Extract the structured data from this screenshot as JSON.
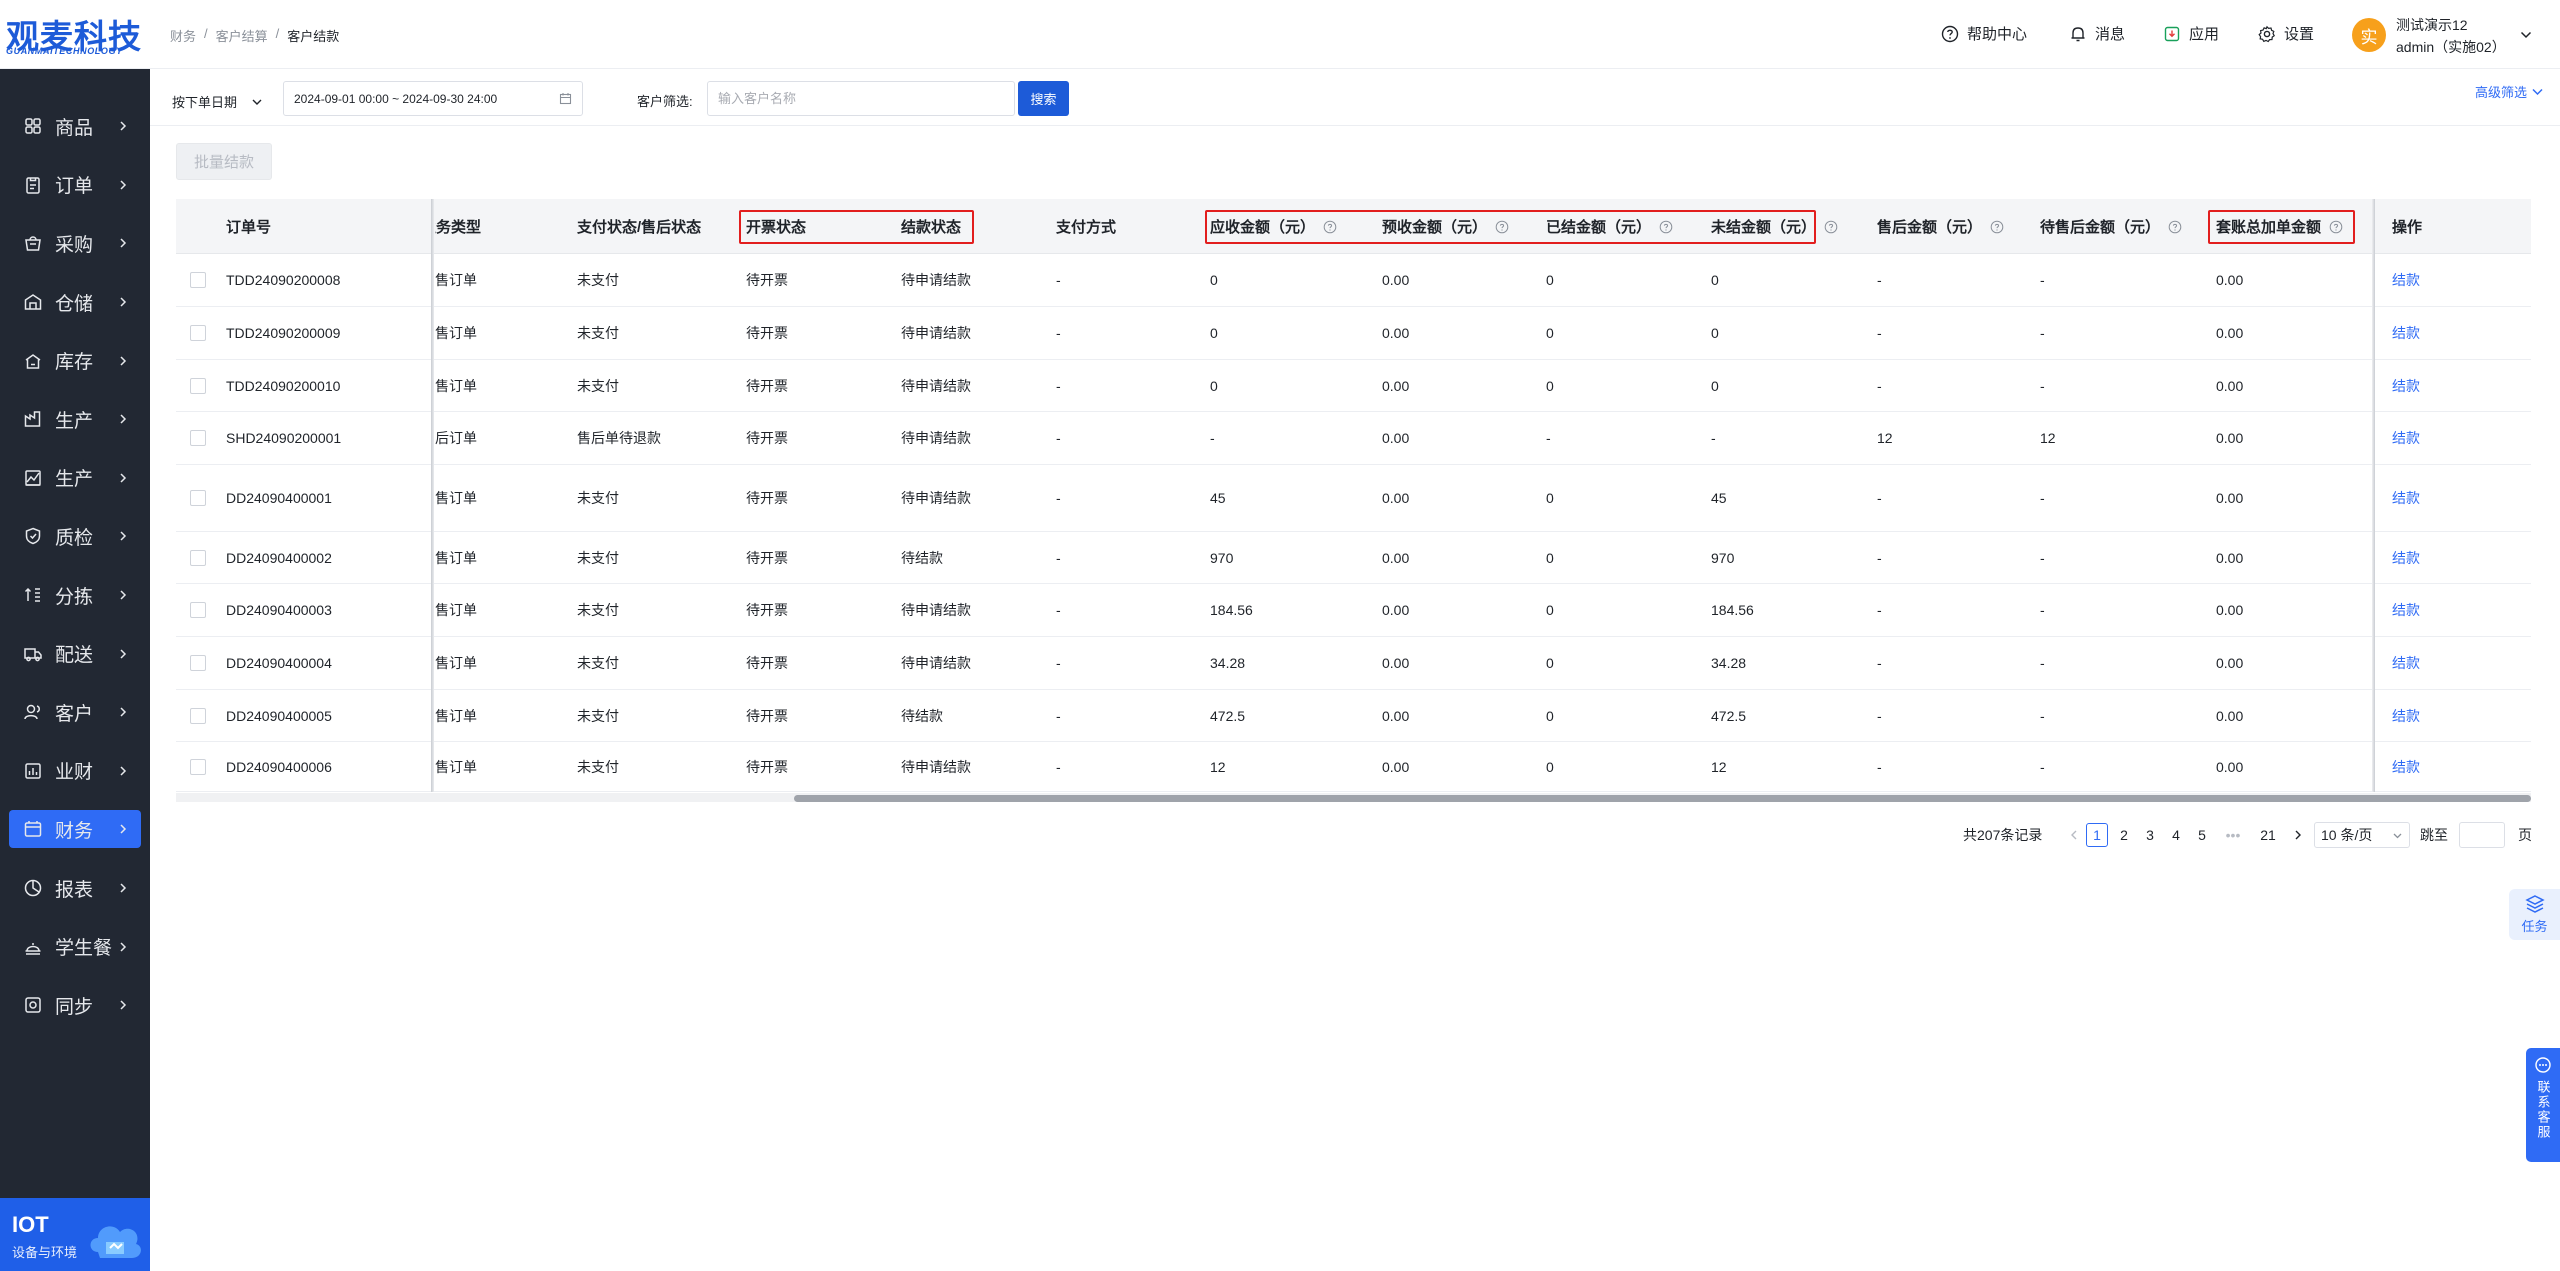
{
  "brand": {
    "logo_text": "观麦科技",
    "logo_sub": "GUANMAITECHNOLOGY"
  },
  "sidebar": {
    "items": [
      {
        "label": "商品",
        "icon": "grid-icon",
        "active": false
      },
      {
        "label": "订单",
        "icon": "order-icon",
        "active": false
      },
      {
        "label": "采购",
        "icon": "purchase-icon",
        "active": false
      },
      {
        "label": "仓储",
        "icon": "warehouse-icon",
        "active": false
      },
      {
        "label": "库存",
        "icon": "inventory-icon",
        "active": false
      },
      {
        "label": "生产",
        "icon": "production-icon",
        "active": false
      },
      {
        "label": "生产",
        "icon": "production-chart-icon",
        "active": false
      },
      {
        "label": "质检",
        "icon": "shield-icon",
        "active": false
      },
      {
        "label": "分拣",
        "icon": "sorting-icon",
        "active": false
      },
      {
        "label": "配送",
        "icon": "truck-icon",
        "active": false
      },
      {
        "label": "客户",
        "icon": "customer-icon",
        "active": false
      },
      {
        "label": "业财",
        "icon": "business-finance-icon",
        "active": false
      },
      {
        "label": "财务",
        "icon": "finance-icon",
        "active": true
      },
      {
        "label": "报表",
        "icon": "report-icon",
        "active": false
      },
      {
        "label": "学生餐",
        "icon": "student-meal-icon",
        "active": false
      },
      {
        "label": "同步",
        "icon": "sync-icon",
        "active": false
      }
    ],
    "iot": {
      "title": "IOT",
      "subtitle": "设备与环境"
    }
  },
  "header": {
    "breadcrumb": [
      "财务",
      "客户结算",
      "客户结款"
    ],
    "nav": [
      {
        "label": "帮助中心",
        "icon": "help-icon"
      },
      {
        "label": "消息",
        "icon": "bell-icon"
      },
      {
        "label": "应用",
        "icon": "app-icon"
      },
      {
        "label": "设置",
        "icon": "gear-icon"
      }
    ],
    "user": {
      "avatar": "实",
      "name": "测试演示12",
      "role": "admin（实施02）"
    }
  },
  "filter": {
    "date_type": "按下单日期",
    "date_range": "2024-09-01 00:00 ~ 2024-09-30 24:00",
    "customer_label": "客户筛选:",
    "customer_placeholder": "输入客户名称",
    "search_label": "搜索",
    "advanced_label": "高级筛选"
  },
  "batch_button": "批量结款",
  "table": {
    "columns": [
      {
        "key": "order_no",
        "label": "订单号",
        "help": false
      },
      {
        "key": "biz_type",
        "label": "业务类型",
        "help": false
      },
      {
        "key": "pay_status",
        "label": "支付状态/售后状态",
        "help": false
      },
      {
        "key": "invoice_status",
        "label": "开票状态",
        "help": false
      },
      {
        "key": "settle_status",
        "label": "结款状态",
        "help": false
      },
      {
        "key": "pay_method",
        "label": "支付方式",
        "help": false
      },
      {
        "key": "receivable",
        "label": "应收金额（元）",
        "help": true
      },
      {
        "key": "prepaid",
        "label": "预收金额（元）",
        "help": true
      },
      {
        "key": "settled",
        "label": "已结金额（元）",
        "help": true
      },
      {
        "key": "unsettled",
        "label": "未结金额（元）",
        "help": true
      },
      {
        "key": "after_sale",
        "label": "售后金额（元）",
        "help": true
      },
      {
        "key": "pending_after_sale",
        "label": "待售后金额（元）",
        "help": true
      },
      {
        "key": "account_extra",
        "label": "套账总加单金额",
        "help": true
      },
      {
        "key": "action",
        "label": "操作",
        "help": false
      }
    ],
    "rows": [
      {
        "order_no": "TDD24090200008",
        "biz_type": "销售订单",
        "pay_status": "未支付",
        "invoice_status": "待开票",
        "settle_status": "待申请结款",
        "pay_method": "-",
        "receivable": "0",
        "prepaid": "0.00",
        "settled": "0",
        "unsettled": "0",
        "after_sale": "-",
        "pending_after_sale": "-",
        "account_extra": "0.00",
        "action": "结款"
      },
      {
        "order_no": "TDD24090200009",
        "biz_type": "销售订单",
        "pay_status": "未支付",
        "invoice_status": "待开票",
        "settle_status": "待申请结款",
        "pay_method": "-",
        "receivable": "0",
        "prepaid": "0.00",
        "settled": "0",
        "unsettled": "0",
        "after_sale": "-",
        "pending_after_sale": "-",
        "account_extra": "0.00",
        "action": "结款"
      },
      {
        "order_no": "TDD24090200010",
        "biz_type": "销售订单",
        "pay_status": "未支付",
        "invoice_status": "待开票",
        "settle_status": "待申请结款",
        "pay_method": "-",
        "receivable": "0",
        "prepaid": "0.00",
        "settled": "0",
        "unsettled": "0",
        "after_sale": "-",
        "pending_after_sale": "-",
        "account_extra": "0.00",
        "action": "结款"
      },
      {
        "order_no": "SHD24090200001",
        "biz_type": "售后订单",
        "pay_status": "售后单待退款",
        "invoice_status": "待开票",
        "settle_status": "待申请结款",
        "pay_method": "-",
        "receivable": "-",
        "prepaid": "0.00",
        "settled": "-",
        "unsettled": "-",
        "after_sale": "12",
        "pending_after_sale": "12",
        "account_extra": "0.00",
        "action": "结款"
      },
      {
        "order_no": "DD24090400001",
        "biz_type": "销售订单",
        "pay_status": "未支付",
        "invoice_status": "待开票",
        "settle_status": "待申请结款",
        "pay_method": "-",
        "receivable": "45",
        "prepaid": "0.00",
        "settled": "0",
        "unsettled": "45",
        "after_sale": "-",
        "pending_after_sale": "-",
        "account_extra": "0.00",
        "action": "结款"
      },
      {
        "order_no": "DD24090400002",
        "biz_type": "销售订单",
        "pay_status": "未支付",
        "invoice_status": "待开票",
        "settle_status": "待结款",
        "pay_method": "-",
        "receivable": "970",
        "prepaid": "0.00",
        "settled": "0",
        "unsettled": "970",
        "after_sale": "-",
        "pending_after_sale": "-",
        "account_extra": "0.00",
        "action": "结款"
      },
      {
        "order_no": "DD24090400003",
        "biz_type": "销售订单",
        "pay_status": "未支付",
        "invoice_status": "待开票",
        "settle_status": "待申请结款",
        "pay_method": "-",
        "receivable": "184.56",
        "prepaid": "0.00",
        "settled": "0",
        "unsettled": "184.56",
        "after_sale": "-",
        "pending_after_sale": "-",
        "account_extra": "0.00",
        "action": "结款"
      },
      {
        "order_no": "DD24090400004",
        "biz_type": "销售订单",
        "pay_status": "未支付",
        "invoice_status": "待开票",
        "settle_status": "待申请结款",
        "pay_method": "-",
        "receivable": "34.28",
        "prepaid": "0.00",
        "settled": "0",
        "unsettled": "34.28",
        "after_sale": "-",
        "pending_after_sale": "-",
        "account_extra": "0.00",
        "action": "结款"
      },
      {
        "order_no": "DD24090400005",
        "biz_type": "销售订单",
        "pay_status": "未支付",
        "invoice_status": "待开票",
        "settle_status": "待结款",
        "pay_method": "-",
        "receivable": "472.5",
        "prepaid": "0.00",
        "settled": "0",
        "unsettled": "472.5",
        "after_sale": "-",
        "pending_after_sale": "-",
        "account_extra": "0.00",
        "action": "结款"
      },
      {
        "order_no": "DD24090400006",
        "biz_type": "销售订单",
        "pay_status": "未支付",
        "invoice_status": "待开票",
        "settle_status": "待申请结款",
        "pay_method": "-",
        "receivable": "12",
        "prepaid": "0.00",
        "settled": "0",
        "unsettled": "12",
        "after_sale": "-",
        "pending_after_sale": "-",
        "account_extra": "0.00",
        "action": "结款"
      }
    ]
  },
  "pagination": {
    "total_text": "共207条记录",
    "pages": [
      "1",
      "2",
      "3",
      "4",
      "5",
      "•••",
      "21"
    ],
    "current": "1",
    "page_size": "10 条/页",
    "jump_label": "跳至",
    "page_unit": "页"
  },
  "floating": {
    "task_label": "任务",
    "contact_label": "联系客服"
  },
  "colors": {
    "sidebar_bg": "#222833",
    "accent": "#2f6bf5",
    "brand": "#1d5bd8",
    "highlight_border": "#e21e1e",
    "avatar": "#f7a01b"
  }
}
